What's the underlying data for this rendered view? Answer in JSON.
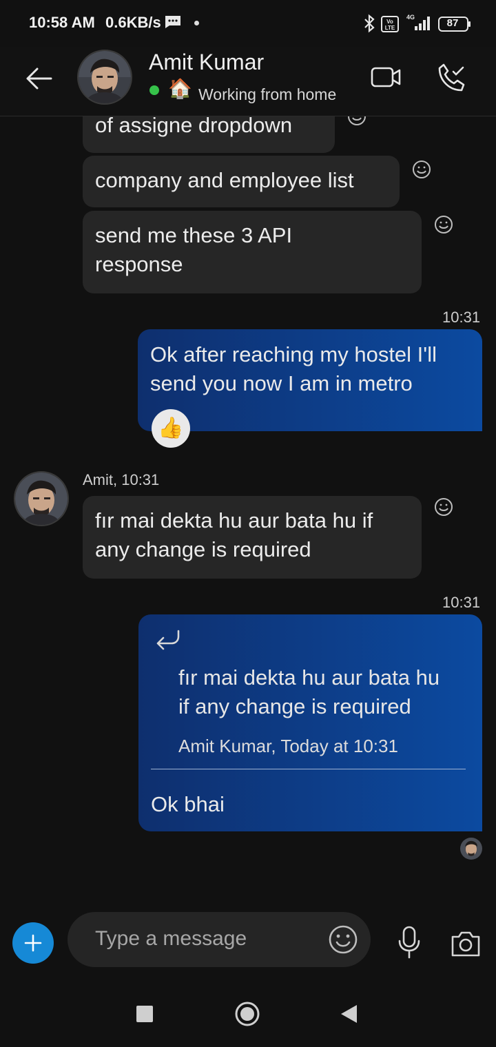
{
  "status_bar": {
    "time": "10:58 AM",
    "speed": "0.6KB/s",
    "network": "4G",
    "battery": "87"
  },
  "header": {
    "contact_name": "Amit Kumar",
    "status_emoji": "🏠",
    "status_text": "Working from home",
    "online_color": "#36c24a"
  },
  "messages": [
    {
      "direction": "in",
      "text": "of assigne dropdown"
    },
    {
      "direction": "in",
      "text": "company and employee list"
    },
    {
      "direction": "in",
      "line1": "send me these 3 API",
      "line2": "response"
    },
    {
      "direction": "out",
      "time": "10:31",
      "line1": "Ok after reaching my hostel I'll",
      "line2": "send you now I am in metro",
      "reaction": "👍"
    },
    {
      "direction": "in",
      "meta": "Amit, 10:31",
      "line1": "fır mai dekta hu aur bata hu if",
      "line2": "any change is required"
    },
    {
      "direction": "out",
      "time": "10:31",
      "quote": {
        "line1": "fır mai dekta hu aur bata hu",
        "line2": "if any change is required",
        "author": "Amit Kumar, Today at 10:31"
      },
      "text": "Ok bhai"
    }
  ],
  "composer": {
    "placeholder": "Type a message"
  },
  "colors": {
    "background": "#111111",
    "incoming_bubble": "#262626",
    "outgoing_bubble_start": "#0e2f6e",
    "outgoing_bubble_end": "#0c4aa0",
    "accent": "#1689d6"
  }
}
